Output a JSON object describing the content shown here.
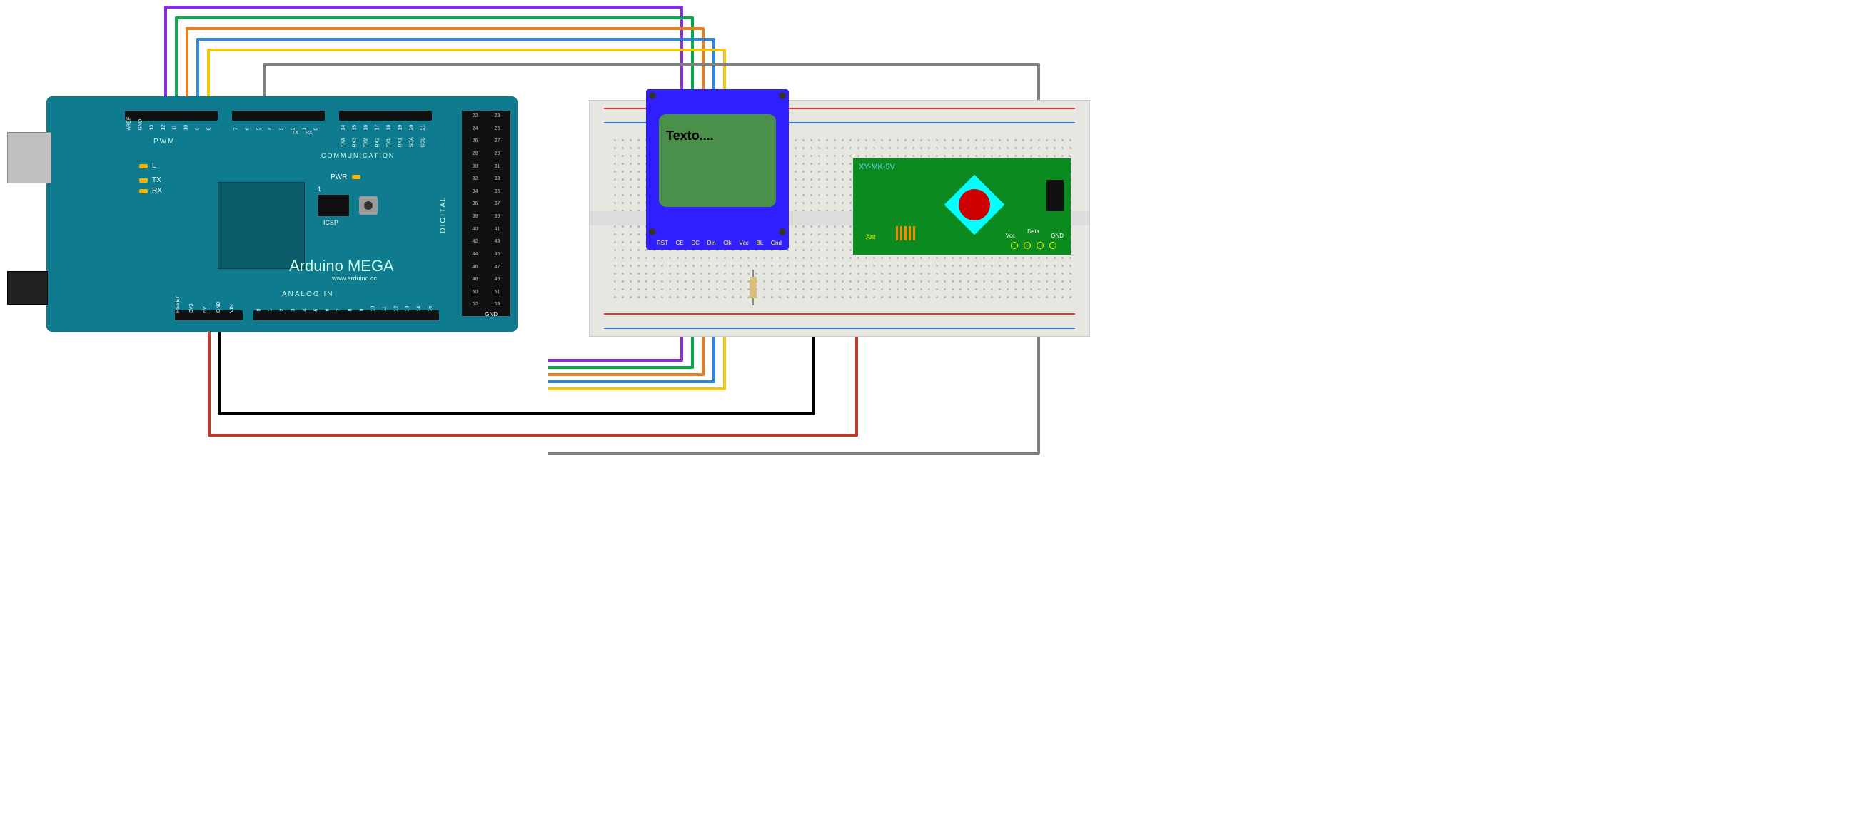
{
  "arduino": {
    "title": "Arduino MEGA",
    "url": "www.arduino.cc",
    "section_pwm": "PWM",
    "section_comm": "COMMUNICATION",
    "section_analog": "ANALOG IN",
    "section_digital": "DIGITAL",
    "icsp_label": "ICSP",
    "pwr_label": "PWR",
    "leds": {
      "L": "L",
      "TX": "TX",
      "RX": "RX"
    },
    "top_pins_left": [
      "AREF",
      "GND",
      "13",
      "12",
      "11",
      "10",
      "9",
      "8"
    ],
    "top_pins_mid": [
      "7",
      "6",
      "5",
      "4",
      "3",
      "2",
      "1",
      "0"
    ],
    "top_pins_right": [
      "14",
      "15",
      "16",
      "17",
      "18",
      "19",
      "20",
      "21"
    ],
    "tx_rx_sub": [
      "TX",
      "RX"
    ],
    "comm_sub": [
      "TX3",
      "RX3",
      "TX2",
      "RX2",
      "TX1",
      "RX1",
      "SDA",
      "SCL"
    ],
    "right_pins_left": [
      "22",
      "24",
      "26",
      "28",
      "30",
      "32",
      "34",
      "36",
      "38",
      "40",
      "42",
      "44",
      "46",
      "48",
      "50",
      "52"
    ],
    "right_pins_right": [
      "23",
      "25",
      "27",
      "29",
      "31",
      "33",
      "35",
      "37",
      "39",
      "41",
      "43",
      "45",
      "47",
      "49",
      "51",
      "53"
    ],
    "right_gnd": "GND",
    "bottom_power": [
      "RESET",
      "3V3",
      "5V",
      "GND",
      "VIN"
    ],
    "bottom_analog": [
      "0",
      "1",
      "2",
      "3",
      "4",
      "5",
      "6",
      "7",
      "8",
      "9",
      "10",
      "11",
      "12",
      "13",
      "14",
      "15"
    ],
    "icsp_num": "1"
  },
  "lcd": {
    "display_text": "Texto....",
    "pin_labels": [
      "RST",
      "CE",
      "DC",
      "Din",
      "Clk",
      "Vcc",
      "BL",
      "Gnd"
    ]
  },
  "rf": {
    "model": "XY-MK-5V",
    "ant_label": "Ant",
    "vcc_label": "Vcc",
    "data_label": "Data",
    "gnd_label": "GND"
  },
  "wire_colors": {
    "rst_purple": "#8a2be2",
    "ce_green": "#0aa84f",
    "dc_orange": "#e67e22",
    "din_blue": "#2e86de",
    "clk_yellow": "#f1c40f",
    "gray": "#808080",
    "red": "#c0392b",
    "black": "#000000"
  },
  "chart_data": {
    "type": "wiring_diagram",
    "board": "Arduino MEGA",
    "components": [
      {
        "name": "Nokia-style LCD (blue)",
        "pins": [
          "RST",
          "CE",
          "DC",
          "Din",
          "Clk",
          "Vcc",
          "BL",
          "Gnd"
        ]
      },
      {
        "name": "RF Receiver XY-MK-5V",
        "pins": [
          "Ant",
          "Vcc",
          "Data",
          "Data",
          "GND"
        ]
      },
      {
        "name": "Resistor (BL series)"
      }
    ],
    "connections": [
      {
        "from": "Arduino D12",
        "to": "LCD RST",
        "color": "purple"
      },
      {
        "from": "Arduino D11",
        "to": "LCD CE",
        "color": "green"
      },
      {
        "from": "Arduino D10",
        "to": "LCD DC",
        "color": "orange"
      },
      {
        "from": "Arduino D9",
        "to": "LCD Din",
        "color": "blue"
      },
      {
        "from": "Arduino D8",
        "to": "LCD Clk",
        "color": "yellow"
      },
      {
        "from": "Arduino D5",
        "to": "RF Data",
        "color": "gray"
      },
      {
        "from": "Arduino 5V",
        "to": "Breadboard + rail / LCD Vcc / RF Vcc",
        "color": "red"
      },
      {
        "from": "Arduino GND",
        "to": "Breadboard - rail / LCD Gnd / RF GND",
        "color": "black"
      },
      {
        "from": "LCD BL",
        "to": "GND via resistor",
        "color": "black"
      }
    ]
  }
}
